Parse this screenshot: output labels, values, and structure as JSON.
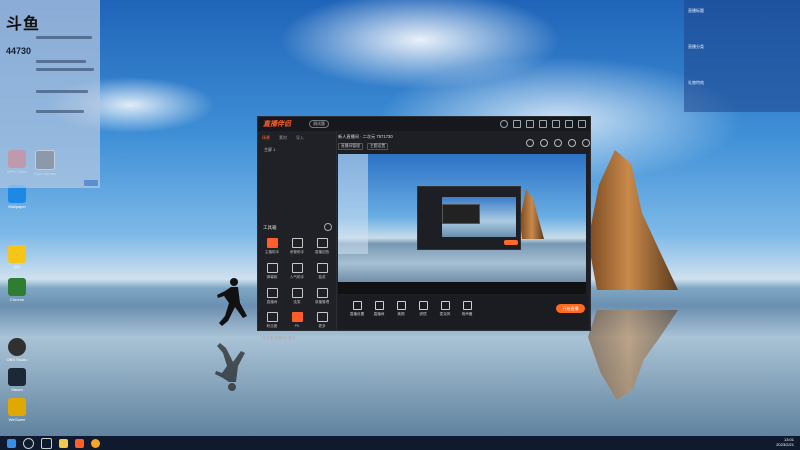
{
  "desktop": {
    "icons": [
      {
        "label": "WPS Office",
        "color": "#d9262c"
      },
      {
        "label": "Epic Games",
        "color": "#222222"
      },
      {
        "label": "Wallpaper",
        "color": "#1e88e5"
      },
      {
        "label": "QQ",
        "color": "#f5c518"
      },
      {
        "label": "Steam",
        "color": "#1b2838"
      },
      {
        "label": "Chrome",
        "color": "#2e7d32"
      },
      {
        "label": "OBS Studio",
        "color": "#303030"
      },
      {
        "label": "WeGame",
        "color": "#e0a800"
      }
    ]
  },
  "left_panel": {
    "logo": "斗鱼",
    "code": "44730"
  },
  "right_panel": {
    "rows": [
      {
        "label": "直播标题"
      },
      {
        "label": "直播分类"
      },
      {
        "label": "礼物特效"
      }
    ]
  },
  "app": {
    "name": "直播伴侣",
    "version_badge": "测试版",
    "header_title": "新人直播间 · 二次元 7571730",
    "header_tags": [
      "直播间管理",
      "主题设置"
    ],
    "sidebar": {
      "tabs": [
        "场景",
        "素材",
        "导入"
      ],
      "scene_item": "主屏 1",
      "tools_title": "工具箱",
      "tools": [
        {
          "label": "主播助手",
          "highlight": true
        },
        {
          "label": "房管助手",
          "highlight": false
        },
        {
          "label": "直播回放",
          "highlight": false
        },
        {
          "label": "弹幕姬",
          "highlight": false
        },
        {
          "label": "人气助手",
          "highlight": false
        },
        {
          "label": "抽奖",
          "highlight": false
        },
        {
          "label": "直播间",
          "highlight": false
        },
        {
          "label": "连麦",
          "highlight": false
        },
        {
          "label": "录播管理",
          "highlight": false
        },
        {
          "label": "粉丝团",
          "highlight": false
        },
        {
          "label": "PK",
          "highlight": false
        },
        {
          "label": "更多",
          "highlight": false
        }
      ],
      "footer": "5 主播 直播间小助手"
    },
    "bottom_bar": [
      {
        "label": "直播设置"
      },
      {
        "label": "直播间"
      },
      {
        "label": "美颜"
      },
      {
        "label": "滤镜"
      },
      {
        "label": "麦克风"
      },
      {
        "label": "扬声器"
      }
    ],
    "live_button": "开始直播"
  },
  "taskbar": {
    "time": "13:01",
    "date": "2023/2/21"
  }
}
